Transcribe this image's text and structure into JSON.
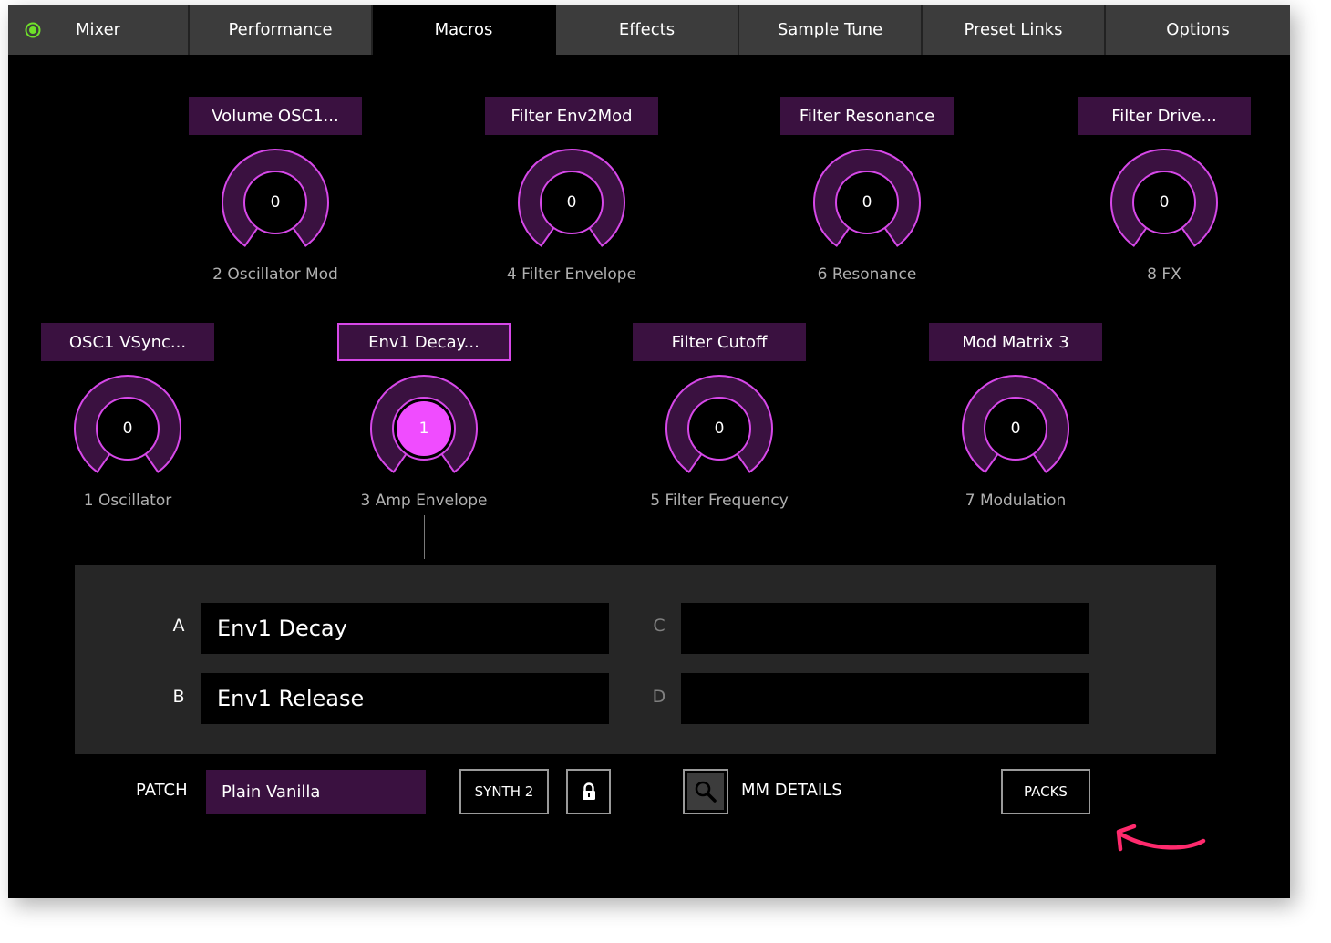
{
  "tabs": [
    {
      "label": "Mixer",
      "active": false
    },
    {
      "label": "Performance",
      "active": false
    },
    {
      "label": "Macros",
      "active": true
    },
    {
      "label": "Effects",
      "active": false
    },
    {
      "label": "Sample Tune",
      "active": false
    },
    {
      "label": "Preset Links",
      "active": false
    },
    {
      "label": "Options",
      "active": false
    }
  ],
  "colors": {
    "accent": "#d648e8",
    "knob_fill": "#3a1140",
    "knob_active": "#f04cff",
    "power_led": "#6fe02a",
    "annotation_arrow": "#ff2a6d"
  },
  "macros": [
    {
      "number_label": "1 Oscillator",
      "target": "OSC1 VSync...",
      "value": "0",
      "selected": false
    },
    {
      "number_label": "2 Oscillator Mod",
      "target": "Volume OSC1...",
      "value": "0",
      "selected": false
    },
    {
      "number_label": "3 Amp Envelope",
      "target": "Env1 Decay...",
      "value": "1",
      "selected": true
    },
    {
      "number_label": "4 Filter Envelope",
      "target": "Filter Env2Mod",
      "value": "0",
      "selected": false
    },
    {
      "number_label": "5 Filter Frequency",
      "target": "Filter Cutoff",
      "value": "0",
      "selected": false
    },
    {
      "number_label": "6 Resonance",
      "target": "Filter Resonance",
      "value": "0",
      "selected": false
    },
    {
      "number_label": "7 Modulation",
      "target": "Mod Matrix 3",
      "value": "0",
      "selected": false
    },
    {
      "number_label": "8 FX",
      "target": "Filter Drive...",
      "value": "0",
      "selected": false
    }
  ],
  "params": {
    "a": {
      "letter": "A",
      "value": "Env1 Decay"
    },
    "b": {
      "letter": "B",
      "value": "Env1 Release"
    },
    "c": {
      "letter": "C",
      "value": ""
    },
    "d": {
      "letter": "D",
      "value": ""
    }
  },
  "footer": {
    "patch_label": "PATCH",
    "patch_name": "Plain Vanilla",
    "synth_button": "SYNTH 2",
    "lock_icon": "lock-icon",
    "search_icon": "magnifier-icon",
    "mm_details_label": "MM DETAILS",
    "packs_button": "PACKS"
  }
}
